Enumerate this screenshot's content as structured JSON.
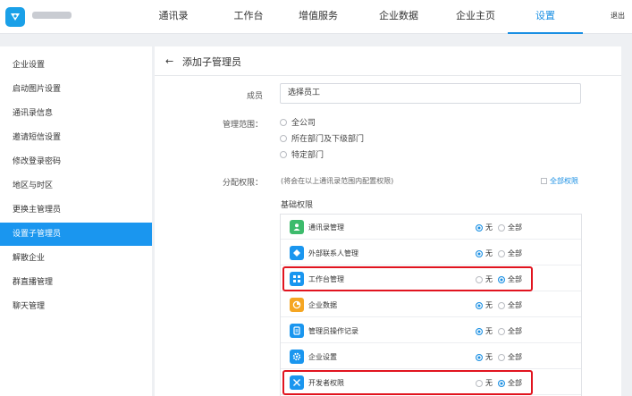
{
  "header": {
    "nav": [
      "通讯录",
      "工作台",
      "增值服务",
      "企业数据",
      "企业主页",
      "设置"
    ],
    "active_nav": "设置",
    "logout": "退出",
    "accent": "#1a8fe3"
  },
  "sidebar": {
    "items": [
      "企业设置",
      "启动图片设置",
      "通讯录信息",
      "邀请短信设置",
      "修改登录密码",
      "地区与时区",
      "更换主管理员",
      "设置子管理员",
      "解散企业",
      "群直播管理",
      "聊天管理"
    ],
    "active": "设置子管理员"
  },
  "page": {
    "back_icon": "←",
    "title": "添加子管理员",
    "member_label": "成员",
    "member_value": "选择员工",
    "scope_label": "管理范围：",
    "scope_options": [
      "全公司",
      "所在部门及下级部门",
      "特定部门"
    ],
    "perm_label": "分配权限：",
    "perm_hint": "(将会在以上通讯录范围内配置权限)",
    "all_perm": "全部权限",
    "basic_perm": "基础权限"
  },
  "permissions": [
    {
      "name": "通讯录管理",
      "icon": "contacts-icon",
      "color": "#3dbb6c",
      "value": "无"
    },
    {
      "name": "外部联系人管理",
      "icon": "external-contacts-icon",
      "color": "#1a96ef",
      "value": "无"
    },
    {
      "name": "工作台管理",
      "icon": "workbench-icon",
      "color": "#1a96ef",
      "value": "全部"
    },
    {
      "name": "企业数据",
      "icon": "data-icon",
      "color": "#f5a623",
      "value": "无"
    },
    {
      "name": "管理员操作记录",
      "icon": "log-icon",
      "color": "#1a96ef",
      "value": "无"
    },
    {
      "name": "企业设置",
      "icon": "settings-icon",
      "color": "#1a96ef",
      "value": "无"
    },
    {
      "name": "开发者权限",
      "icon": "developer-icon",
      "color": "#1a96ef",
      "value": "全部"
    }
  ],
  "option_labels": {
    "none": "无",
    "all": "全部"
  }
}
